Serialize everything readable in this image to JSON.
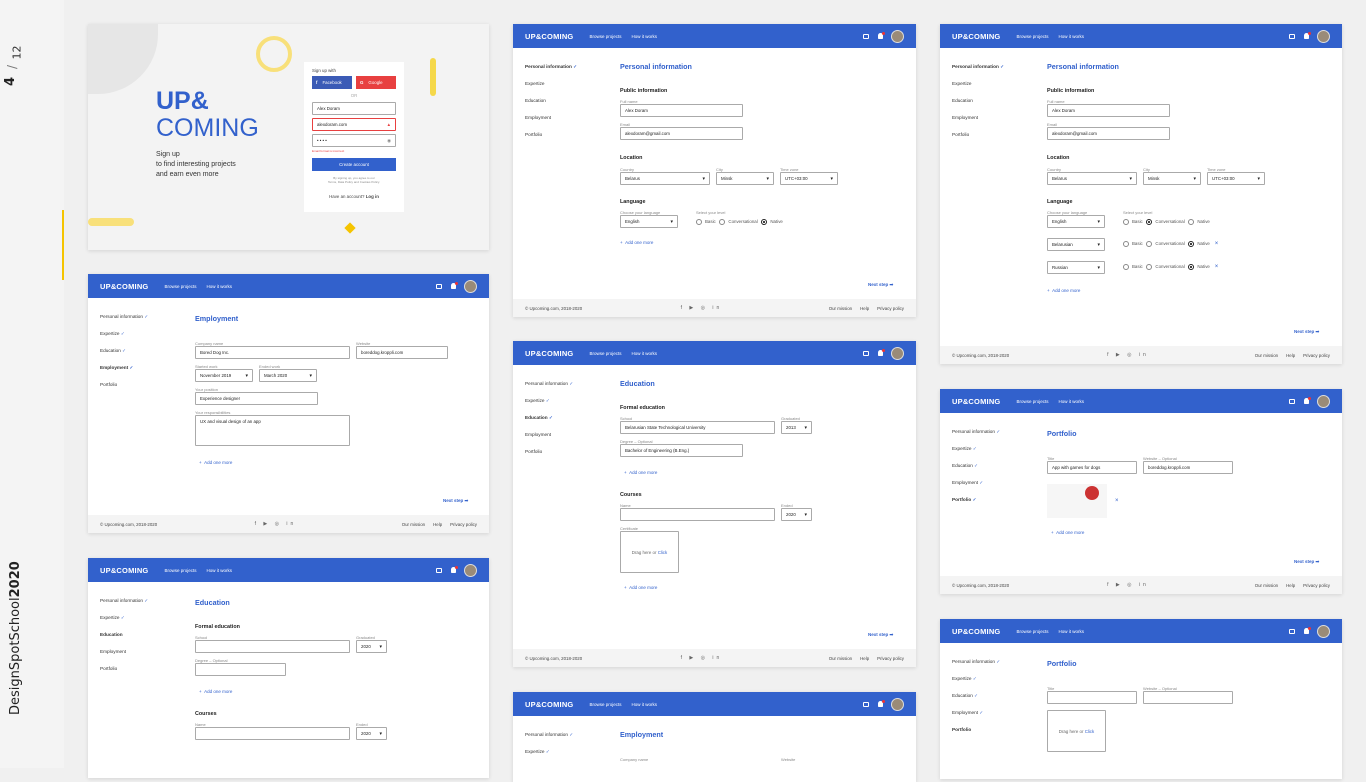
{
  "page": {
    "current": "4",
    "total": "12",
    "brand_light": "DesignSpotSchool",
    "brand_year": "2020"
  },
  "common": {
    "logo": "UP&COMING",
    "nav1": "Browse projects",
    "nav2": "How it works",
    "footer": "© Upcoming.com, 2018-2020",
    "mission": "Our mission",
    "help": "Help",
    "privacy": "Privacy policy",
    "add_more": "Add one more",
    "next": "Next step ➡",
    "social": "f ▶ ◎ in",
    "steps": [
      "Personal information",
      "Expertize",
      "Education",
      "Employment",
      "Portfolio"
    ],
    "check": "✓"
  },
  "signup": {
    "logo_l1": "UP&",
    "logo_l2": "COMING",
    "tag1": "Sign up",
    "tag2": "to find interesting projects",
    "tag3": "and earn even more",
    "with": "Sign up with",
    "facebook": "Facebook",
    "google": "Google",
    "or": "OR",
    "name": "Alex Doram",
    "email": "alexdoram.com",
    "password": "• • • •",
    "error": "Email format is incorrect",
    "create": "Create account",
    "terms1": "By signing up, you agree to our",
    "terms2": "Terms, Data Policy and Cookies Policy.",
    "have": "Have an account?",
    "login": "Log in"
  },
  "personal": {
    "title": "Personal information",
    "public": "Public information",
    "full_name_lbl": "Full name",
    "full_name": "Alex Doram",
    "email_lbl": "Email",
    "email": "alexdoram@gmail.com",
    "location": "Location",
    "country_lbl": "Country",
    "country": "Belarus",
    "city_lbl": "City",
    "city": "Minsk",
    "tz_lbl": "Time zone",
    "tz": "UTC+03:00",
    "language": "Language",
    "choose_lang": "Choose your language",
    "level_lbl": "Select your level",
    "basic": "Basic",
    "conv": "Conversational",
    "native": "Native",
    "lang1": "English",
    "lang2": "Belarusian",
    "lang3": "Russian"
  },
  "employment": {
    "title": "Employment",
    "company_lbl": "Company name",
    "company": "Bored Dog Inc.",
    "website_lbl": "Website",
    "website": "boreddog.kroppli.com",
    "started_lbl": "Started work",
    "started": "November 2019",
    "ended_lbl": "Ended work",
    "ended": "March 2020",
    "position_lbl": "Your position",
    "position": "Experience designer",
    "resp_lbl": "Your responsibilities",
    "resp": "UX and visual design of an app"
  },
  "education": {
    "title": "Education",
    "formal": "Formal education",
    "school_lbl": "School",
    "school": "Belarusian State Technological University",
    "grad_lbl": "Graduated",
    "grad": "2013",
    "grad_empty": "2020",
    "degree_lbl": "Degree – Optional",
    "degree": "Bachelor of Engineering (B.Eng.)",
    "courses": "Courses",
    "name_lbl": "Name",
    "ended_lbl": "Ended",
    "ended": "2020",
    "cert_lbl": "Certificate",
    "drag": "Drag here or",
    "click": "Click"
  },
  "portfolio": {
    "title": "Portfolio",
    "title_lbl": "Title",
    "title_val": "App with games for dogs",
    "web_lbl": "Website – Optional",
    "web_val": "boreddog.kroppli.com"
  }
}
